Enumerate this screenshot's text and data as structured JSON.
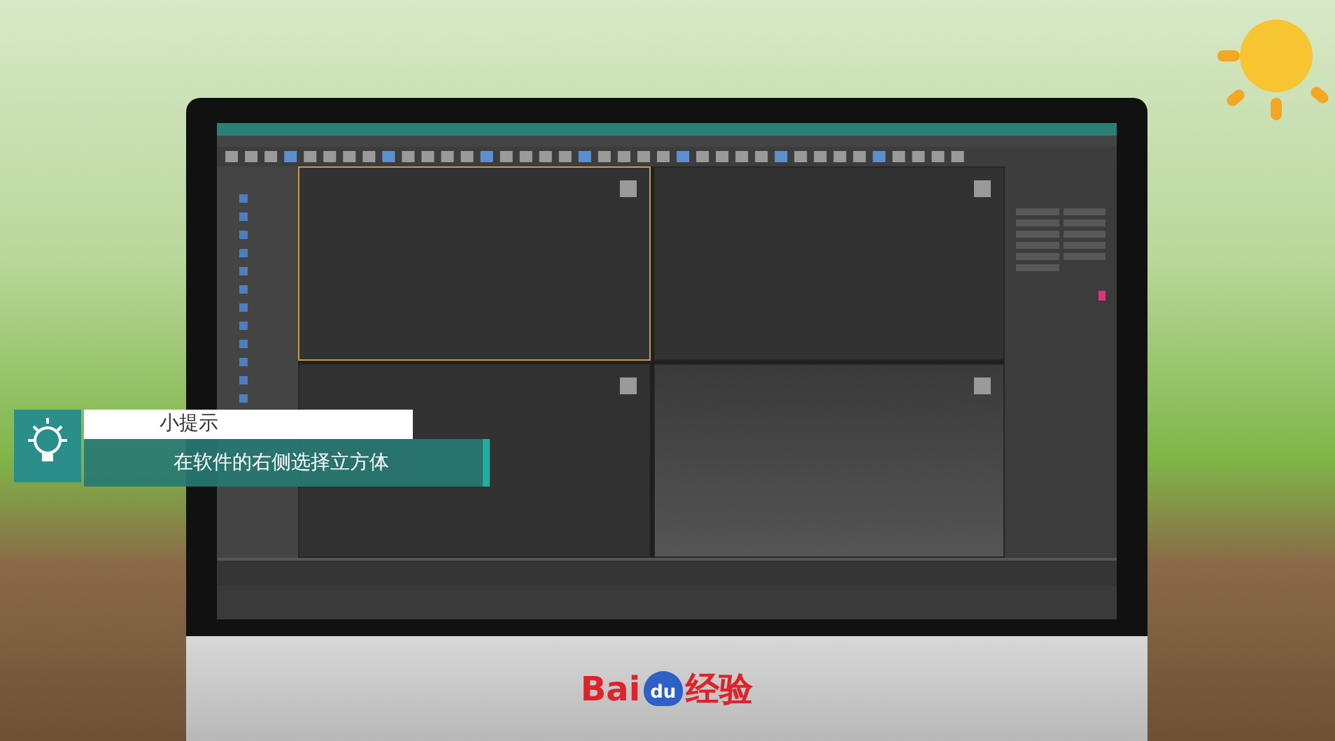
{
  "viewports": [
    {
      "selected": true
    },
    {
      "selected": false
    },
    {
      "selected": false
    },
    {
      "selected": false
    }
  ],
  "tip": {
    "title": "小提示",
    "text": "在软件的右侧选择立方体"
  },
  "brand": {
    "prefix": "Bai",
    "paw_text": "du",
    "suffix": "经验"
  }
}
